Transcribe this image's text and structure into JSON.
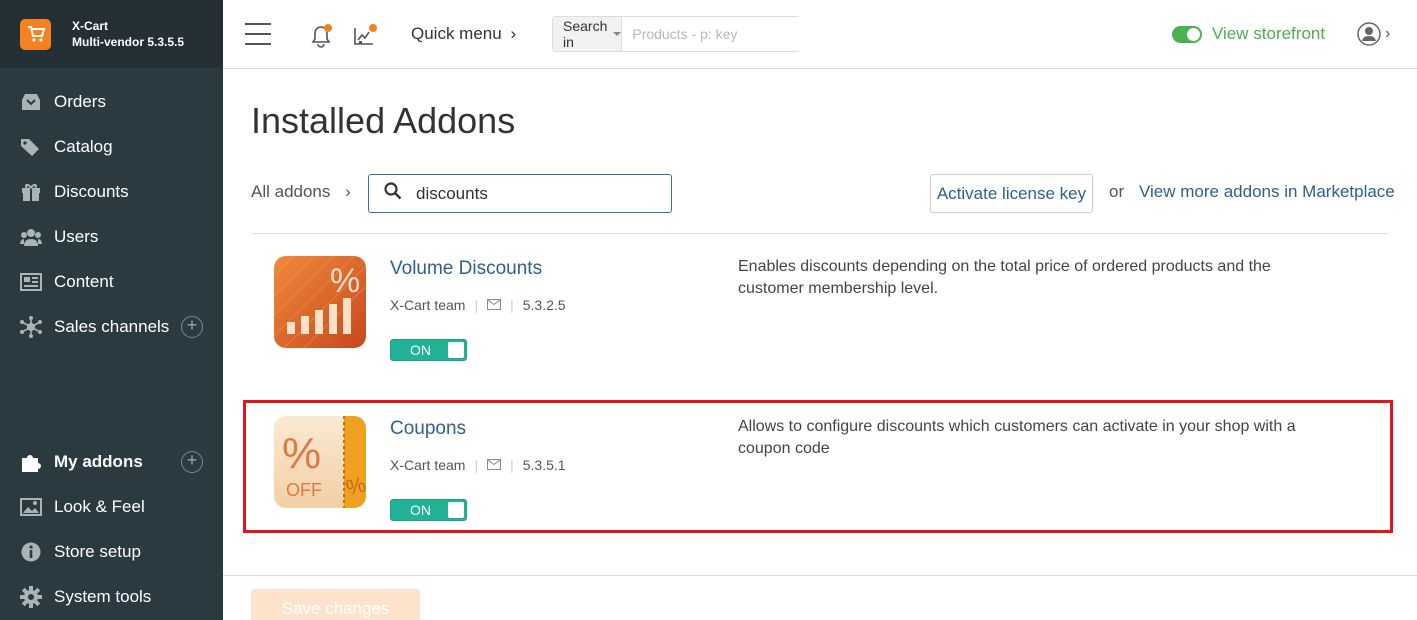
{
  "brand": {
    "name": "X-Cart",
    "version": "Multi-vendor 5.3.5.5",
    "logo_icon": "cart-logo",
    "accent": "#f5821f"
  },
  "sidebar": {
    "items": [
      {
        "label": "Orders",
        "icon": "orders-icon"
      },
      {
        "label": "Catalog",
        "icon": "tag-icon"
      },
      {
        "label": "Discounts",
        "icon": "gift-icon"
      },
      {
        "label": "Users",
        "icon": "users-icon"
      },
      {
        "label": "Content",
        "icon": "content-icon"
      },
      {
        "label": "Sales channels",
        "icon": "network-icon"
      },
      {
        "label": "My addons",
        "icon": "puzzle-icon",
        "active": true
      },
      {
        "label": "Look & Feel",
        "icon": "image-icon"
      },
      {
        "label": "Store setup",
        "icon": "info-icon"
      },
      {
        "label": "System tools",
        "icon": "gear-icon"
      }
    ]
  },
  "header": {
    "quick_menu": "Quick menu",
    "search_in": "Search in",
    "search_placeholder": "Products - p: key",
    "storefront_label": "View storefront"
  },
  "main": {
    "title": "Installed Addons",
    "all_addons": "All addons",
    "filter_value": "discounts",
    "license_button": "Activate license key",
    "or_text": "or",
    "marketplace_link": "View more addons in Marketplace",
    "addons": [
      {
        "name": "Volume Discounts",
        "author": "X-Cart team",
        "version": "5.3.2.5",
        "state": "ON",
        "description": "Enables discounts depending on the total price of ordered products and the customer membership level."
      },
      {
        "name": "Coupons",
        "author": "X-Cart team",
        "version": "5.3.5.1",
        "state": "ON",
        "description": "Allows to configure discounts which customers can activate in your shop with a coupon code",
        "icon_text": "OFF"
      }
    ],
    "save_button": "Save changes"
  },
  "colors": {
    "sidebar_bg": "#2b3940",
    "link": "#2e5f8e",
    "toggle_on": "#22b394",
    "highlight": "#e0161a",
    "storefront": "#4caf50"
  }
}
